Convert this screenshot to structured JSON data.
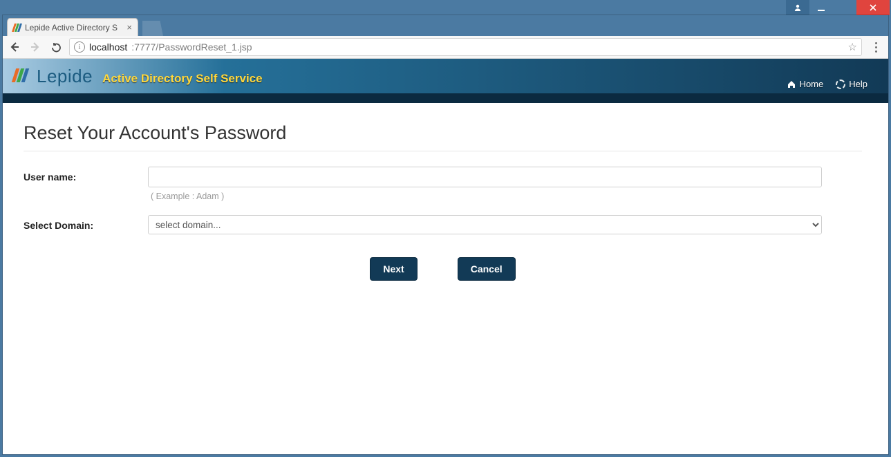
{
  "window": {
    "tabs": [
      {
        "title": "Lepide Active Directory S"
      }
    ]
  },
  "browser": {
    "url_host": "localhost",
    "url_rest": ":7777/PasswordReset_1.jsp"
  },
  "app": {
    "brand_name": "Lepide",
    "brand_subtitle": "Active Directory Self Service",
    "nav": {
      "home": "Home",
      "help": "Help"
    }
  },
  "page": {
    "heading": "Reset Your Account's Password",
    "form": {
      "username_label": "User name:",
      "username_value": "",
      "username_hint": "( Example : Adam )",
      "domain_label": "Select Domain:",
      "domain_selected": "select domain..."
    },
    "buttons": {
      "next": "Next",
      "cancel": "Cancel"
    }
  }
}
